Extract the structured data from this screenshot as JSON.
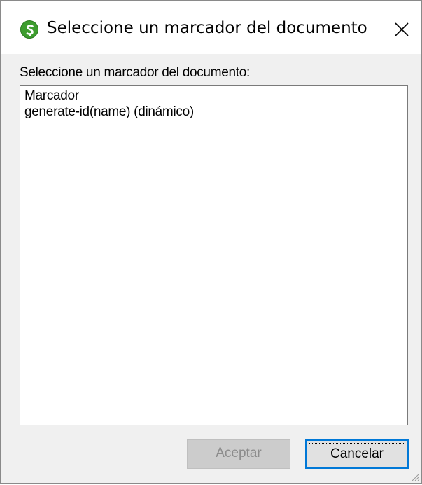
{
  "window": {
    "title": "Seleccione un marcador del documento",
    "app_icon": "altova-stylevision-icon",
    "close_icon": "close-icon"
  },
  "dialog": {
    "prompt": "Seleccione un marcador del documento:",
    "list_items": [
      "Marcador",
      "generate-id(name) (dinámico)"
    ]
  },
  "buttons": {
    "ok_label": "Aceptar",
    "ok_enabled": false,
    "cancel_label": "Cancelar",
    "cancel_focused": true
  },
  "colors": {
    "focus_border": "#0078d7",
    "icon_green": "#3d9d2e"
  }
}
